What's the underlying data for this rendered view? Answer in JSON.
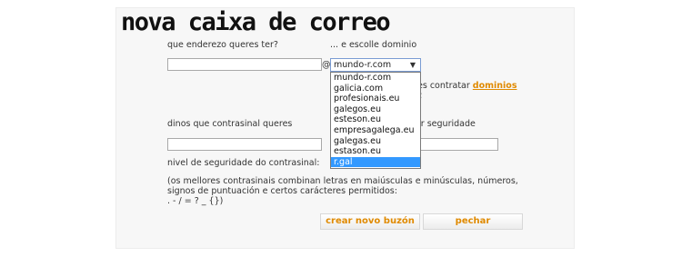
{
  "title": "nova caixa de correo",
  "labels": {
    "address": "que enderezo queres ter?",
    "domain": "... e escolle dominio",
    "password": "dinos que contrasinal queres",
    "security_partial": "or seguridade",
    "strength": "nivel de seguridade do contrasinal:"
  },
  "at_sign": "@",
  "domain_select": {
    "selected": "mundo-r.com",
    "options": [
      "mundo-r.com",
      "galicia.com",
      "profesionais.eu",
      "galegos.eu",
      "esteson.eu",
      "empresagalega.eu",
      "galegas.eu",
      "estason.eu",
      "r.gal"
    ],
    "highlighted": "r.gal"
  },
  "hint": {
    "text": "es contratar ",
    "link": "dominios",
    "line2": "t"
  },
  "note": "(os mellores contrasinais combinan letras en maiúsculas e minúsculas, números, signos de puntuación e certos carácteres permitidos:\n. - / = ? _ {})",
  "buttons": {
    "create": "crear novo buzón",
    "close": "pechar"
  },
  "colors": {
    "accent": "#e08a00",
    "highlight": "#3399ff"
  }
}
